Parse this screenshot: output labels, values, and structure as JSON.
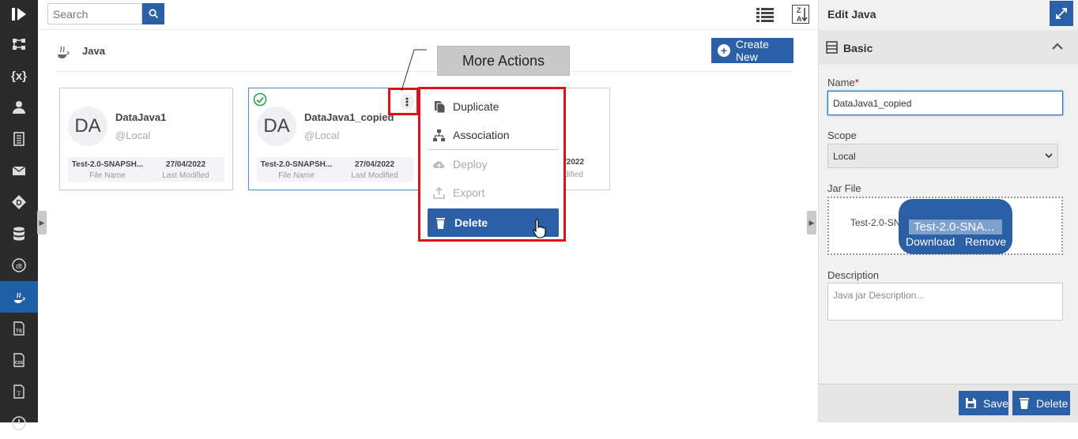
{
  "search": {
    "placeholder": "Search"
  },
  "sidebar": {
    "items": [
      {
        "icon": "logo-icon"
      },
      {
        "icon": "flows-icon"
      },
      {
        "icon": "variables-icon",
        "label": "{x}"
      },
      {
        "icon": "user-icon"
      },
      {
        "icon": "document-icon"
      },
      {
        "icon": "mail-icon"
      },
      {
        "icon": "diamond-d-icon",
        "label": "D"
      },
      {
        "icon": "database-icon"
      },
      {
        "icon": "dt-icon",
        "label": "dt"
      },
      {
        "icon": "java-icon"
      },
      {
        "icon": "ts-file-icon",
        "label": "TS"
      },
      {
        "icon": "css-file-icon",
        "label": "CSS"
      },
      {
        "icon": "text-file-icon",
        "label": "T"
      },
      {
        "icon": "clock-icon"
      }
    ]
  },
  "breadcrumb": {
    "title": "Java"
  },
  "toolbar": {
    "create_label": "Create New"
  },
  "cards": [
    {
      "avatar": "DA",
      "name": "DataJava1",
      "scope": "@Local",
      "file_name": "Test-2.0-SNAPSH...",
      "file_label": "File Name",
      "modified": "27/04/2022",
      "modified_label": "Last Modified",
      "selected": false
    },
    {
      "avatar": "DA",
      "name": "DataJava1_copied",
      "scope": "@Local",
      "file_name": "Test-2.0-SNAPSH...",
      "file_label": "File Name",
      "modified": "27/04/2022",
      "modified_label": "Last Modified",
      "selected": true
    }
  ],
  "third_card": {
    "modified_partial": "/2022",
    "label_partial": "dified"
  },
  "callout": {
    "text": "More Actions"
  },
  "menu": {
    "items": [
      {
        "label": "Duplicate",
        "icon": "duplicate-icon",
        "disabled": false
      },
      {
        "label": "Association",
        "icon": "association-icon",
        "disabled": false
      },
      {
        "label": "Deploy",
        "icon": "cloud-upload-icon",
        "disabled": true
      },
      {
        "label": "Export",
        "icon": "export-icon",
        "disabled": true
      },
      {
        "label": "Delete",
        "icon": "trash-icon",
        "disabled": false
      }
    ]
  },
  "panel": {
    "title": "Edit Java",
    "section": "Basic",
    "name_label": "Name",
    "name_required": "*",
    "name_value": "DataJava1_copied",
    "scope_label": "Scope",
    "scope_value": "Local",
    "jar_label": "Jar File",
    "jar_name_partial": "Test-2.0-SN",
    "jar_popup_name": "Test-2.0-SNA...",
    "download_label": "Download",
    "remove_label": "Remove",
    "description_label": "Description",
    "description_placeholder": "Java jar Description...",
    "save_label": "Save",
    "delete_label": "Delete"
  },
  "colors": {
    "accent": "#2b5fa6",
    "highlight": "#e0101a",
    "rail": "#2b2b2b"
  }
}
